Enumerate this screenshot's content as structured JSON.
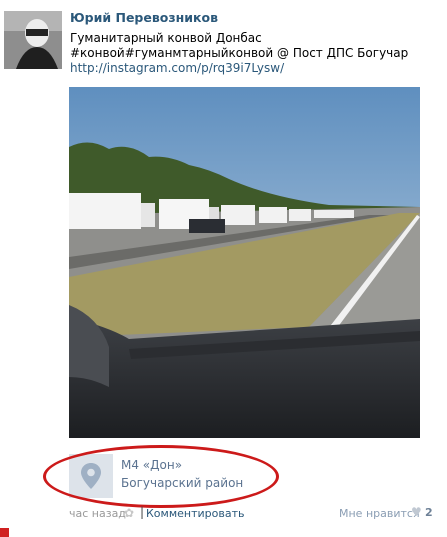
{
  "post": {
    "author": "Юрий Перевозников",
    "text_line1": "Гуманитарный конвой Донбас",
    "text_line2": "#конвой#гуманмтарныйконвой @ Пост ДПС Богучар",
    "link": "http://instagram.com/p/rq39i7Lysw/"
  },
  "place": {
    "name": "М4 «Дон»",
    "district": "Богучарский район",
    "icon": "map-pin-icon"
  },
  "footer": {
    "time": "час назад",
    "separator": "|",
    "comment": "Комментировать",
    "like_label": "Мне нравится",
    "like_count": "2",
    "heart_glyph": "♥",
    "gear_glyph": "✿"
  },
  "colors": {
    "link": "#2b587a",
    "highlight_ring": "#cc1a1a"
  }
}
